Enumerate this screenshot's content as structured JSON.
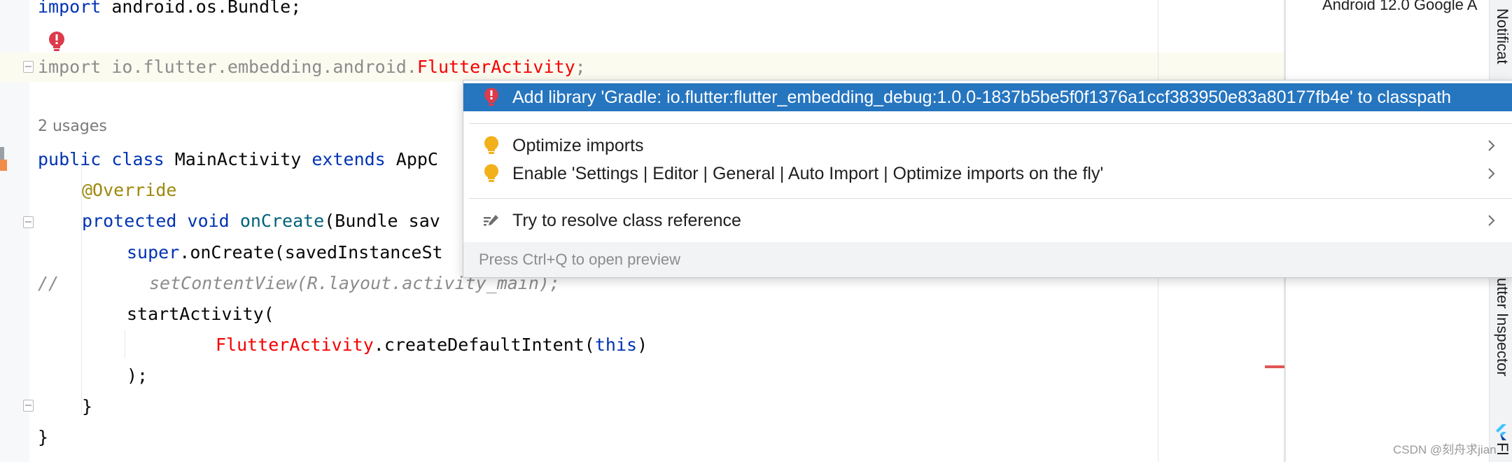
{
  "editor": {
    "lines": {
      "l1": {
        "kw": "import",
        "rest": " android.os.Bundle;"
      },
      "l3": {
        "pre": "import io.flutter.embedding.android.",
        "cls": "FlutterActivity",
        "end": ";"
      },
      "usages": "2 usages",
      "l5": {
        "kw1": "public",
        "kw2": "class",
        "name": " MainActivity ",
        "kw3": "extends",
        "rest": " AppC"
      },
      "l6": {
        "ann": "@Override"
      },
      "l7": {
        "kw1": "protected",
        "kw2": "void",
        "mth": "onCreate",
        "rest": "(Bundle sav"
      },
      "l8": {
        "kw": "super",
        "rest": ".onCreate(savedInstanceSt"
      },
      "l9": {
        "slashes": "//",
        "code": "setContentView(R.layout.activity_main);"
      },
      "l10": {
        "text": "startActivity("
      },
      "l11": {
        "cls": "FlutterActivity",
        "mid": ".createDefaultIntent(",
        "kw": "this",
        "end": ")"
      },
      "l12": {
        "text": ");"
      },
      "l13": {
        "text": "}"
      },
      "l14": {
        "text": "}"
      }
    }
  },
  "popup": {
    "items": [
      {
        "label": "Add library 'Gradle: io.flutter:flutter_embedding_debug:1.0.0-1837b5be5f0f1376a1ccf383950e83a80177fb4e' to classpath",
        "icon": "error-bulb-icon",
        "selected": true
      },
      {
        "label": "Optimize imports",
        "icon": "bulb-icon",
        "has_submenu": true
      },
      {
        "label": "Enable 'Settings | Editor | General | Auto Import | Optimize imports on the fly'",
        "icon": "bulb-icon",
        "has_submenu": true
      },
      {
        "label": "Try to resolve class reference",
        "icon": "edit-pencil-icon",
        "has_submenu": true
      }
    ],
    "footer": "Press Ctrl+Q to open preview"
  },
  "right_panel": {
    "device": "Android 12.0 Google A",
    "notifications_tab": "Notificat",
    "flutter_inspector_tab": "lutter Inspector",
    "flutter_tab": "Fl"
  },
  "watermark": "CSDN @刻舟求jian",
  "colors": {
    "selection": "#2675bf",
    "keyword": "#0033b3",
    "error_class": "#f50000",
    "annotation": "#9e880d",
    "method": "#00627a",
    "comment": "#8c8c8c"
  }
}
